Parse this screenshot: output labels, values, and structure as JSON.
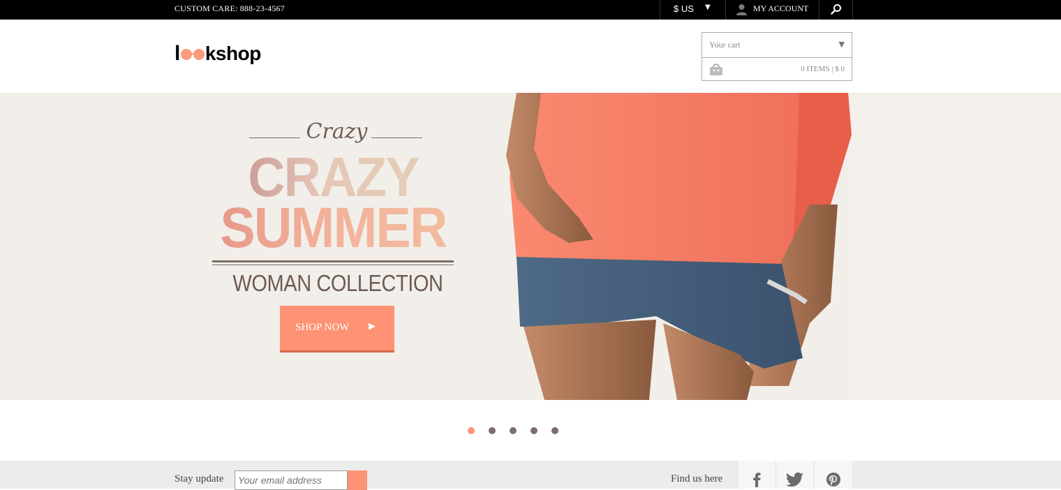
{
  "topbar": {
    "custom_care": "CUSTOM CARE: 888-23-4567",
    "currency": "$ US",
    "account_label": "MY ACCOUNT"
  },
  "header": {
    "logo_text": "kshop",
    "cart": {
      "placeholder": "Your cart",
      "summary": "0 ITEMS | $ 0"
    }
  },
  "hero": {
    "script_word": "Crazy",
    "headline_line1": "CRAZY",
    "headline_line2": "SUMMER",
    "subtitle": "WOMAN COLLECTION",
    "button_label": "SHOP NOW"
  },
  "slider": {
    "slide_count": 5,
    "active_index": 0
  },
  "footer": {
    "stay_label": "Stay update",
    "email_placeholder": "Your email address",
    "find_label": "Find us here"
  },
  "colors": {
    "accent": "#fe9274",
    "topbar": "#000000",
    "hero_bg": "#f2efea",
    "footer_bg": "#ececec"
  },
  "icons": [
    "caret-down-icon",
    "user-icon",
    "search-icon",
    "shopping-bag-icon",
    "play-icon",
    "facebook-icon",
    "twitter-icon",
    "pinterest-icon"
  ]
}
